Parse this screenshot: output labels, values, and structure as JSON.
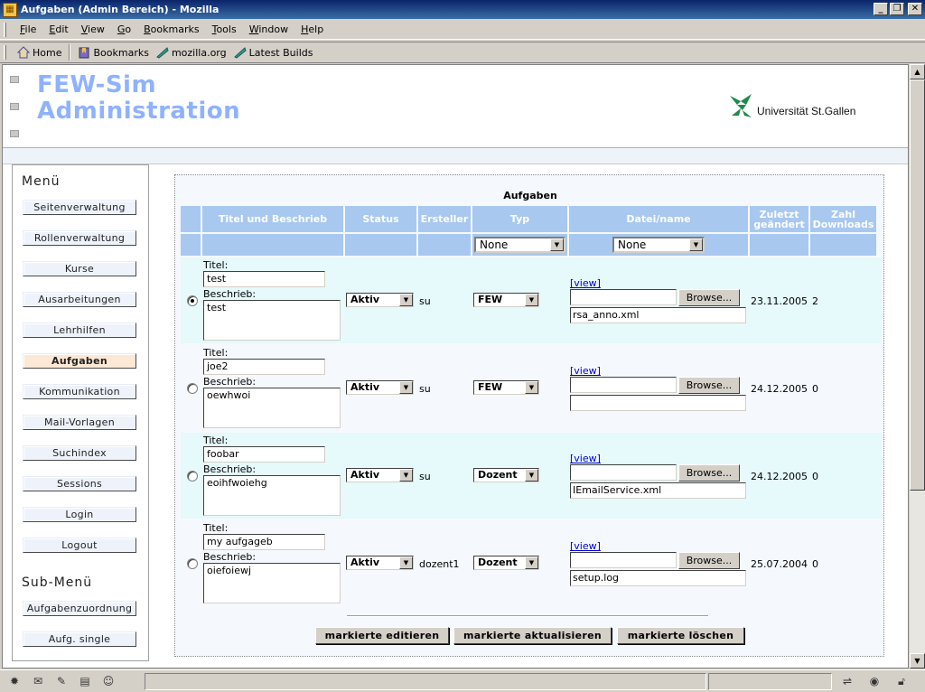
{
  "window": {
    "title": "Aufgaben (Admin Bereich) - Mozilla",
    "min": "_",
    "max": "❐",
    "close": "✕"
  },
  "menu": [
    {
      "label": "File",
      "key": "F",
      "rest": "ile"
    },
    {
      "label": "Edit",
      "key": "E",
      "rest": "dit"
    },
    {
      "label": "View",
      "key": "V",
      "rest": "iew"
    },
    {
      "label": "Go",
      "key": "G",
      "rest": "o"
    },
    {
      "label": "Bookmarks",
      "key": "B",
      "rest": "ookmarks"
    },
    {
      "label": "Tools",
      "key": "T",
      "rest": "ools"
    },
    {
      "label": "Window",
      "key": "W",
      "rest": "indow"
    },
    {
      "label": "Help",
      "key": "H",
      "rest": "elp"
    }
  ],
  "toolbar": {
    "home": "Home",
    "bookmarks": "Bookmarks",
    "mozilla": "mozilla.org",
    "latest": "Latest Builds"
  },
  "header": {
    "brand_line1": "FEW-Sim",
    "brand_line2": "Administration",
    "university": "Universität St.Gallen"
  },
  "sidebar": {
    "menu_heading": "Menü",
    "items": [
      "Seitenverwaltung",
      "Rollenverwaltung",
      "Kurse",
      "Ausarbeitungen",
      "Lehrhilfen",
      "Aufgaben",
      "Kommunikation",
      "Mail-Vorlagen",
      "Suchindex",
      "Sessions",
      "Login",
      "Logout"
    ],
    "active_index": 5,
    "submenu_heading": "Sub-Menü",
    "sub_items": [
      "Aufgabenzuordnung",
      "Aufg. single"
    ]
  },
  "main": {
    "title": "Aufgaben",
    "columns": {
      "title_desc": "Titel und Beschrieb",
      "status": "Status",
      "creator": "Ersteller",
      "type": "Typ",
      "file": "Datei/name",
      "changed_1": "Zuletzt",
      "changed_2": "geändert",
      "downloads_1": "Zahl",
      "downloads_2": "Downloads"
    },
    "filters": {
      "type": "None",
      "file": "None"
    },
    "labels": {
      "title": "Titel:",
      "desc": "Beschrieb:",
      "view": "[view]",
      "browse": "Browse..."
    },
    "rows": [
      {
        "selected": true,
        "title": "test",
        "desc": "test",
        "status": "Aktiv",
        "creator": "su",
        "type": "FEW",
        "filename": "rsa_anno.xml",
        "changed": "23.11.2005",
        "downloads": "2"
      },
      {
        "selected": false,
        "title": "joe2",
        "desc": "oewhwoi",
        "status": "Aktiv",
        "creator": "su",
        "type": "FEW",
        "filename": "",
        "changed": "24.12.2005",
        "downloads": "0"
      },
      {
        "selected": false,
        "title": "foobar",
        "desc": "eoihfwoiehg",
        "status": "Aktiv",
        "creator": "su",
        "type": "Dozent",
        "filename": "IEmailService.xml",
        "changed": "24.12.2005",
        "downloads": "0"
      },
      {
        "selected": false,
        "title": "my aufgageb",
        "desc": "oiefoiewj",
        "status": "Aktiv",
        "creator": "dozent1",
        "type": "Dozent",
        "filename": "setup.log",
        "changed": "25.07.2004",
        "downloads": "0"
      }
    ],
    "actions": {
      "edit": "markierte editieren",
      "update": "markierte aktualisieren",
      "delete": "markierte löschen"
    }
  }
}
